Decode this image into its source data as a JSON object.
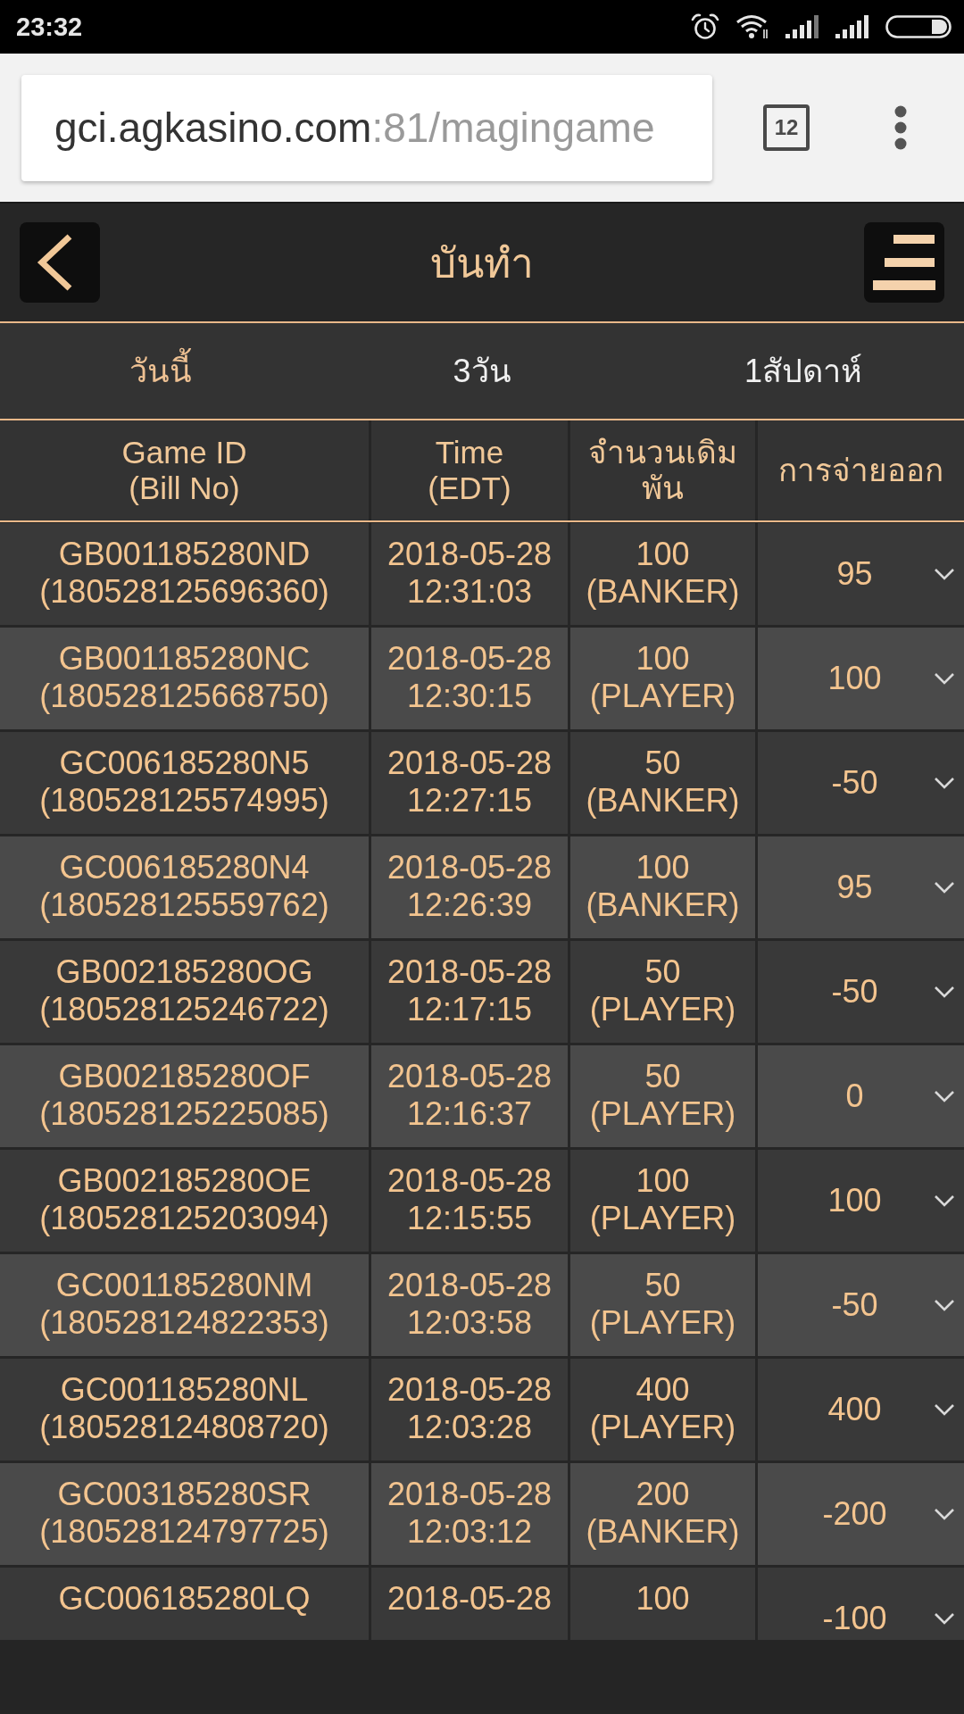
{
  "status_bar": {
    "time": "23:32"
  },
  "browser": {
    "url_host": "gci.agkasino.com",
    "url_path": ":81/magingame",
    "tab_count": "12"
  },
  "header": {
    "title": "บันทำ"
  },
  "tabs": [
    {
      "label": "วันนี้",
      "selected": true
    },
    {
      "label": "3วัน",
      "selected": false
    },
    {
      "label": "1สัปดาห์",
      "selected": false
    }
  ],
  "table": {
    "columns": [
      {
        "lines": [
          "Game ID",
          "(Bill No)"
        ]
      },
      {
        "lines": [
          "Time",
          "(EDT)"
        ]
      },
      {
        "lines": [
          "จำนวนเดิมพัน"
        ]
      },
      {
        "lines": [
          "การจ่ายออก"
        ]
      }
    ],
    "rows": [
      {
        "game_id": "GB001185280ND",
        "bill_no": "(180528125696360)",
        "date": "2018-05-28",
        "time": "12:31:03",
        "amount": "100",
        "side": "(BANKER)",
        "payout": "95",
        "expanded": false
      },
      {
        "game_id": "GB001185280NC",
        "bill_no": "(180528125668750)",
        "date": "2018-05-28",
        "time": "12:30:15",
        "amount": "100",
        "side": "(PLAYER)",
        "payout": "100",
        "expanded": false
      },
      {
        "game_id": "GC006185280N5",
        "bill_no": "(180528125574995)",
        "date": "2018-05-28",
        "time": "12:27:15",
        "amount": "50",
        "side": "(BANKER)",
        "payout": "-50",
        "expanded": false
      },
      {
        "game_id": "GC006185280N4",
        "bill_no": "(180528125559762)",
        "date": "2018-05-28",
        "time": "12:26:39",
        "amount": "100",
        "side": "(BANKER)",
        "payout": "95",
        "expanded": false
      },
      {
        "game_id": "GB002185280OG",
        "bill_no": "(180528125246722)",
        "date": "2018-05-28",
        "time": "12:17:15",
        "amount": "50",
        "side": "(PLAYER)",
        "payout": "-50",
        "expanded": false
      },
      {
        "game_id": "GB002185280OF",
        "bill_no": "(180528125225085)",
        "date": "2018-05-28",
        "time": "12:16:37",
        "amount": "50",
        "side": "(PLAYER)",
        "payout": "0",
        "expanded": false
      },
      {
        "game_id": "GB002185280OE",
        "bill_no": "(180528125203094)",
        "date": "2018-05-28",
        "time": "12:15:55",
        "amount": "100",
        "side": "(PLAYER)",
        "payout": "100",
        "expanded": false
      },
      {
        "game_id": "GC001185280NM",
        "bill_no": "(180528124822353)",
        "date": "2018-05-28",
        "time": "12:03:58",
        "amount": "50",
        "side": "(PLAYER)",
        "payout": "-50",
        "expanded": false
      },
      {
        "game_id": "GC001185280NL",
        "bill_no": "(180528124808720)",
        "date": "2018-05-28",
        "time": "12:03:28",
        "amount": "400",
        "side": "(PLAYER)",
        "payout": "400",
        "expanded": false
      },
      {
        "game_id": "GC003185280SR",
        "bill_no": "(180528124797725)",
        "date": "2018-05-28",
        "time": "12:03:12",
        "amount": "200",
        "side": "(BANKER)",
        "payout": "-200",
        "expanded": false
      },
      {
        "game_id": "GC006185280LQ",
        "date": "2018-05-28",
        "amount": "100",
        "payout": "-100",
        "expanded": false
      }
    ]
  }
}
